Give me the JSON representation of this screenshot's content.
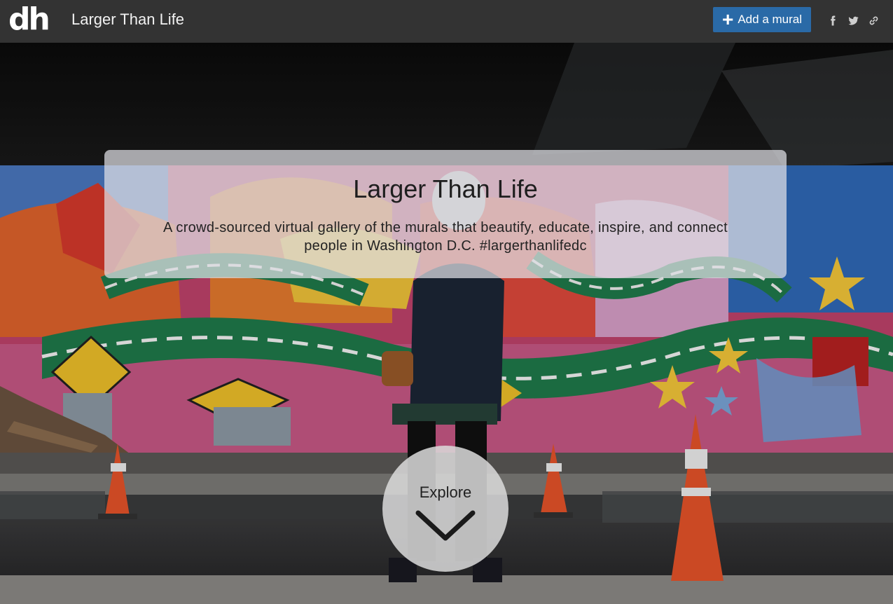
{
  "header": {
    "logo_text": "dh",
    "title": "Larger Than Life",
    "add_button_label": "Add a mural",
    "add_button_icon": "plus-icon",
    "share_icons": [
      "facebook-icon",
      "twitter-icon",
      "link-icon"
    ],
    "bar_color": "#333333",
    "button_color": "#2a6aa7"
  },
  "intro": {
    "title": "Larger Than Life",
    "description": "A crowd-sourced virtual gallery of the murals that beautify, educate, inspire, and connect people in Washington D.C. #largerthanlifedc"
  },
  "explore": {
    "label": "Explore",
    "icon": "chevron-down-icon"
  }
}
